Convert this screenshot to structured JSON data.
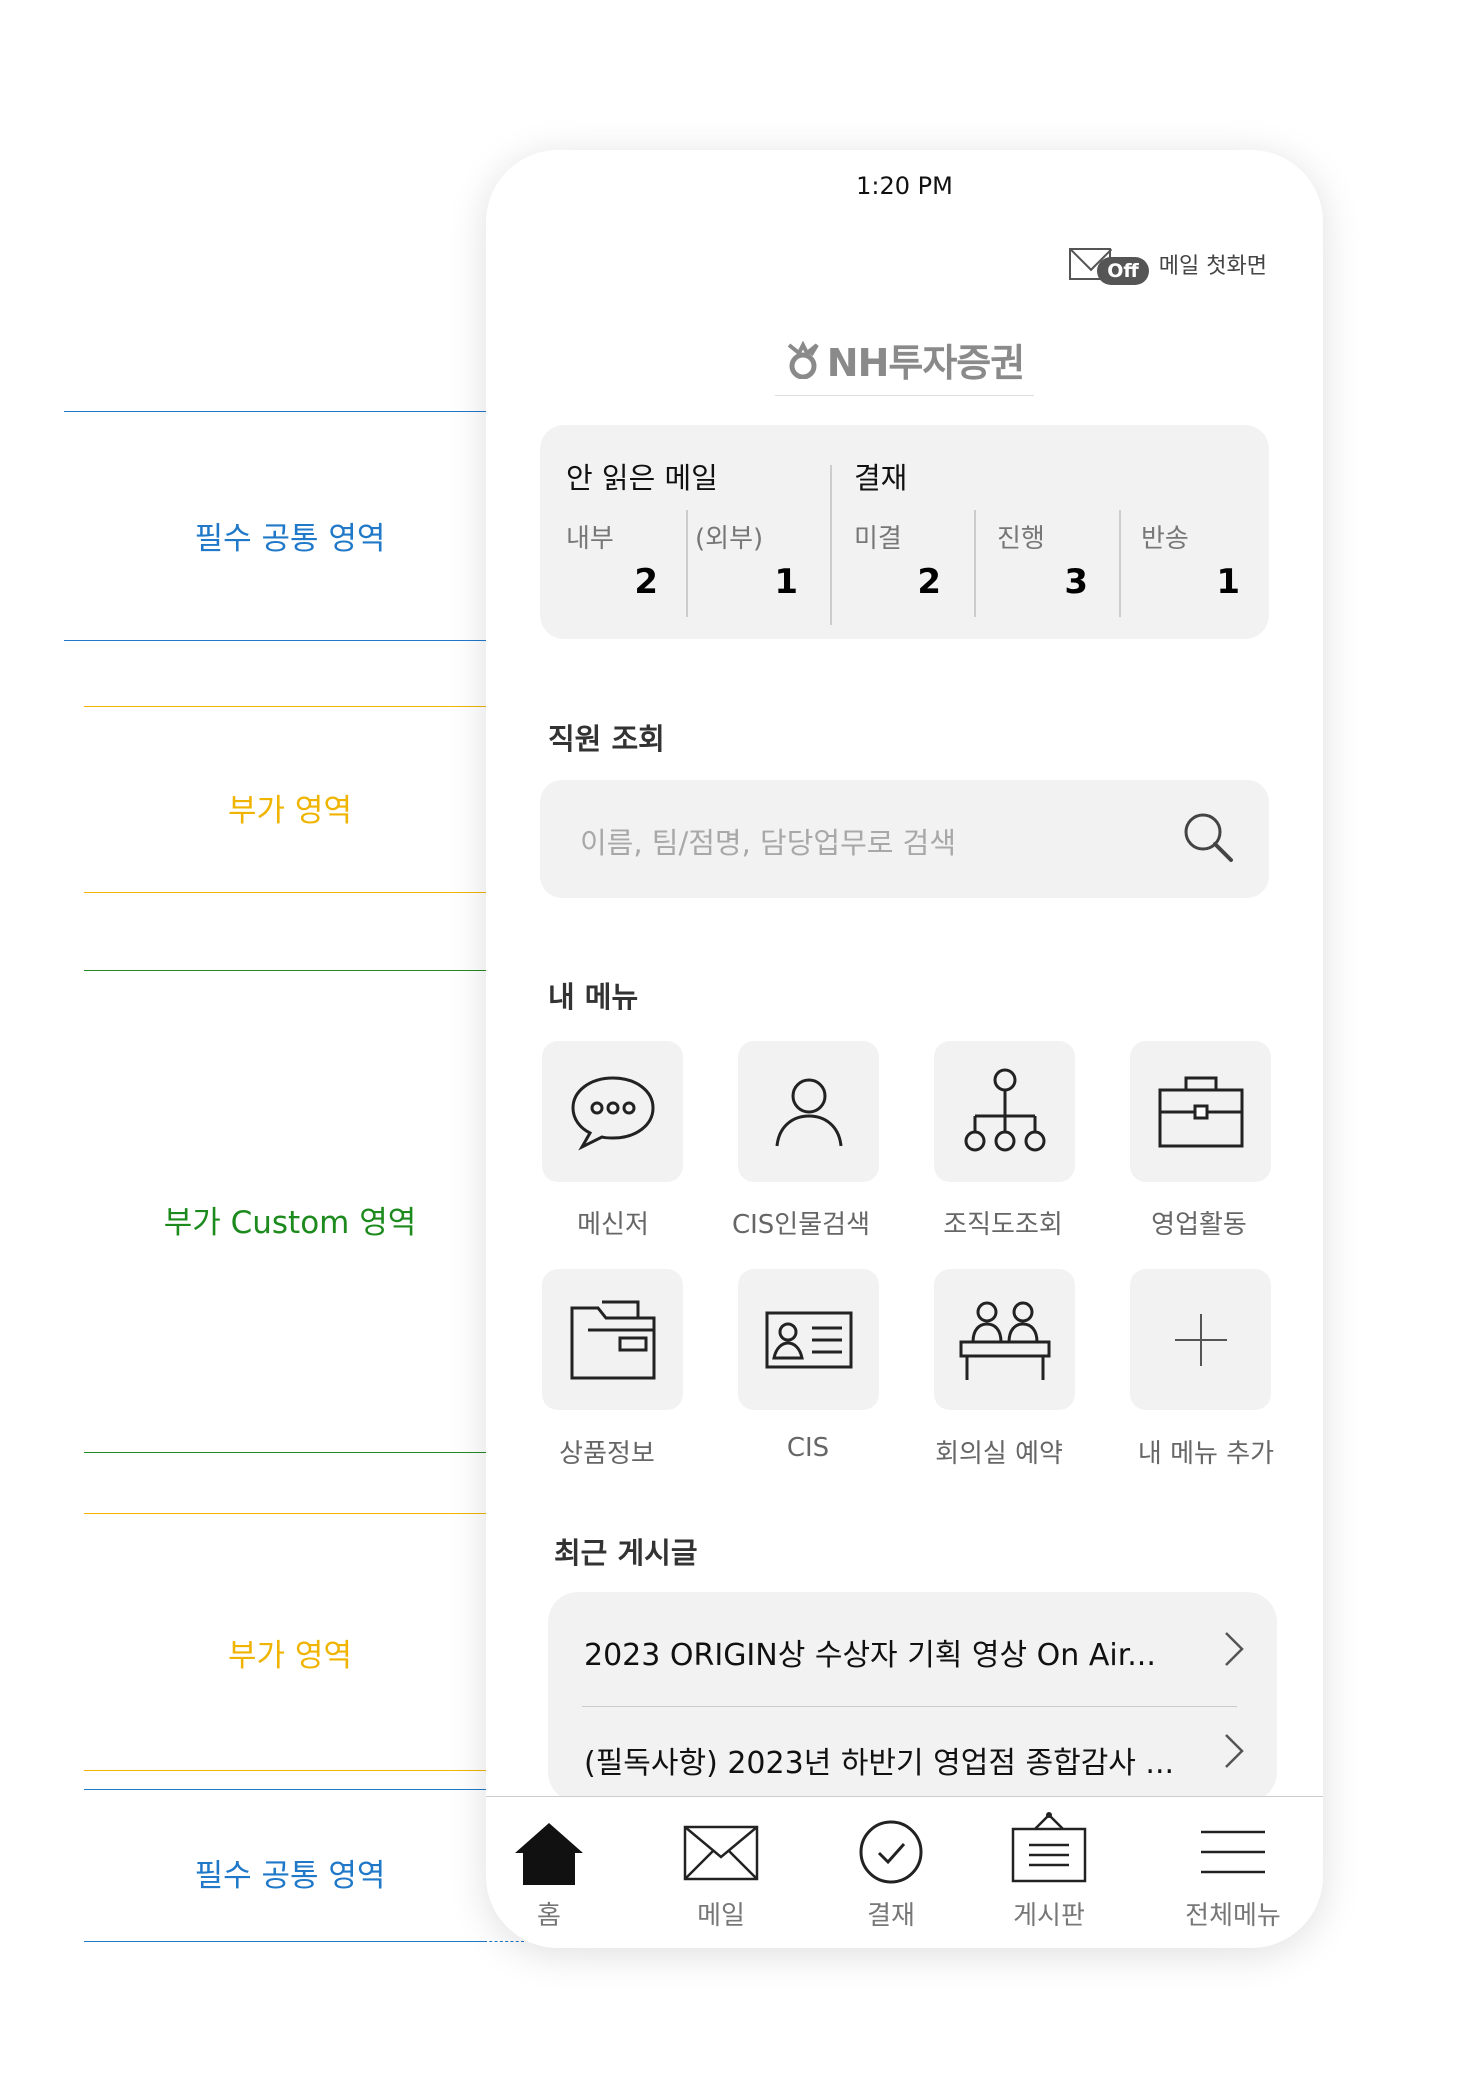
{
  "annotations": {
    "required_common_top": "필수 공통 영역",
    "additional_search": "부가 영역",
    "additional_custom": "부가 Custom 영역",
    "additional_posts": "부가 영역",
    "required_common_bottom": "필수 공통 영역",
    "colors": {
      "required": "#1f78c8",
      "additional": "#f0b400",
      "custom": "#1c8a1c"
    }
  },
  "status_bar": {
    "time": "1:20 PM"
  },
  "mail_toggle": {
    "state": "Off",
    "label": "메일 첫화면"
  },
  "logo": {
    "text": "NH투자증권"
  },
  "summary": {
    "unread_mail": {
      "title": "안 읽은 메일",
      "items": [
        {
          "label": "내부",
          "value": "2"
        },
        {
          "label": "(외부)",
          "value": "1"
        }
      ]
    },
    "approval": {
      "title": "결재",
      "items": [
        {
          "label": "미결",
          "value": "2"
        },
        {
          "label": "진행",
          "value": "3"
        },
        {
          "label": "반송",
          "value": "1"
        }
      ]
    }
  },
  "employee_search": {
    "title": "직원 조회",
    "placeholder": "이름, 팀/점명, 담당업무로 검색"
  },
  "my_menu": {
    "title": "내 메뉴",
    "items": [
      {
        "label": "메신저",
        "icon": "messenger-icon"
      },
      {
        "label": "CIS인물검색",
        "icon": "person-icon"
      },
      {
        "label": "조직도조회",
        "icon": "org-chart-icon"
      },
      {
        "label": "영업활동",
        "icon": "briefcase-icon"
      },
      {
        "label": "상품정보",
        "icon": "folder-icon"
      },
      {
        "label": "CIS",
        "icon": "id-card-icon"
      },
      {
        "label": "회의실 예약",
        "icon": "meeting-room-icon"
      },
      {
        "label": "내 메뉴 추가",
        "icon": "plus-icon"
      }
    ]
  },
  "recent_posts": {
    "title": "최근 게시글",
    "items": [
      {
        "title": "2023 ORIGIN상  수상자 기획 영상 On Air..."
      },
      {
        "title": "(필독사항) 2023년 하반기 영업점 종합감사 ..."
      }
    ]
  },
  "tab_bar": {
    "items": [
      {
        "label": "홈",
        "icon": "home-icon",
        "active": true
      },
      {
        "label": "메일",
        "icon": "mail-icon"
      },
      {
        "label": "결재",
        "icon": "approval-check-icon"
      },
      {
        "label": "게시판",
        "icon": "board-icon"
      },
      {
        "label": "전체메뉴",
        "icon": "hamburger-menu-icon"
      }
    ]
  }
}
